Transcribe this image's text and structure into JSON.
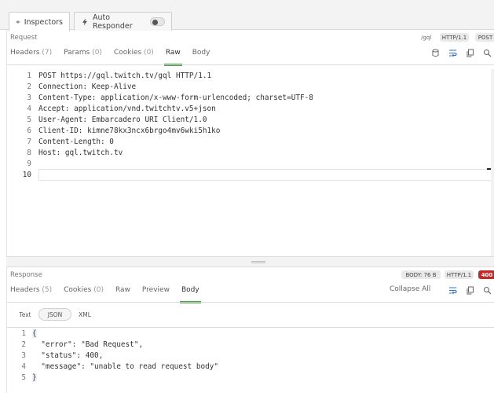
{
  "tabs": [
    {
      "label": "Inspectors",
      "icon": "eye-icon"
    },
    {
      "label": "Auto Responder",
      "icon": "lightning-icon"
    }
  ],
  "request": {
    "title": "Request",
    "path": "/gql",
    "protocol": "HTTP/1.1",
    "method": "POST",
    "subtabs": [
      {
        "label": "Headers",
        "count": "(7)"
      },
      {
        "label": "Params",
        "count": "(0)"
      },
      {
        "label": "Cookies",
        "count": "(0)"
      },
      {
        "label": "Raw",
        "count": ""
      },
      {
        "label": "Body",
        "count": ""
      }
    ],
    "active_subtab": "Raw",
    "raw_lines": [
      {
        "n": "1",
        "t": "POST https://gql.twitch.tv/gql HTTP/1.1"
      },
      {
        "n": "2",
        "t": "Connection: Keep-Alive"
      },
      {
        "n": "3",
        "t": "Content-Type: application/x-www-form-urlencoded; charset=UTF-8"
      },
      {
        "n": "4",
        "t": "Accept: application/vnd.twitchtv.v5+json"
      },
      {
        "n": "5",
        "t": "User-Agent: Embarcadero URI Client/1.0"
      },
      {
        "n": "6",
        "t": "Client-ID: kimne78kx3ncx6brgo4mv6wki5h1ko"
      },
      {
        "n": "7",
        "t": "Content-Length: 0"
      },
      {
        "n": "8",
        "t": "Host: gql.twitch.tv"
      },
      {
        "n": "9",
        "t": ""
      },
      {
        "n": "10",
        "t": ""
      }
    ]
  },
  "response": {
    "title": "Response",
    "body_size": "BODY: 76 B",
    "protocol": "HTTP/1.1",
    "status": "400",
    "subtabs": [
      {
        "label": "Headers",
        "count": "(5)"
      },
      {
        "label": "Cookies",
        "count": "(0)"
      },
      {
        "label": "Raw",
        "count": ""
      },
      {
        "label": "Preview",
        "count": ""
      },
      {
        "label": "Body",
        "count": ""
      }
    ],
    "active_subtab": "Body",
    "collapse_all": "Collapse All",
    "formats": [
      "Text",
      "JSON",
      "XML"
    ],
    "active_format": "JSON",
    "body_lines": [
      {
        "n": "1",
        "t": "{"
      },
      {
        "n": "2",
        "t": "  \"error\": \"Bad Request\","
      },
      {
        "n": "3",
        "t": "  \"status\": 400,"
      },
      {
        "n": "4",
        "t": "  \"message\": \"unable to read request body\""
      },
      {
        "n": "5",
        "t": "}"
      }
    ]
  }
}
